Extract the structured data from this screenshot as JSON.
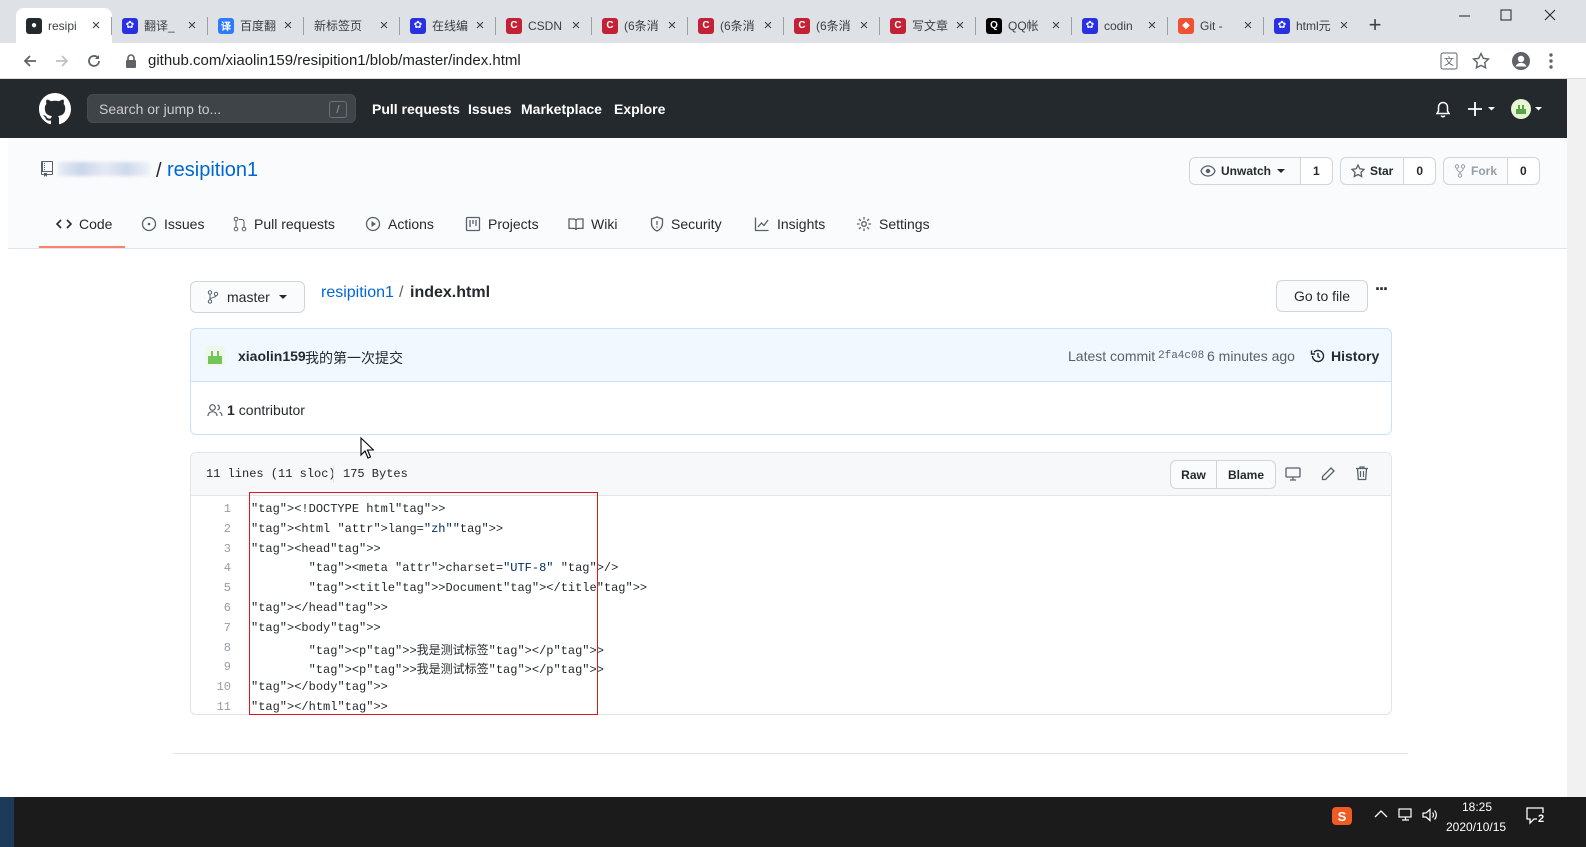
{
  "browser": {
    "tabs": [
      {
        "title": "resipi",
        "icon": "github-icon",
        "color": "#24292e"
      },
      {
        "title": "翻译_",
        "icon": "baidu-paw-icon",
        "color": "#2932e1"
      },
      {
        "title": "百度翻",
        "icon": "baidu-translate-icon",
        "color": "#2f7bff"
      },
      {
        "title": "新标签页",
        "icon": "none",
        "color": ""
      },
      {
        "title": "在线编",
        "icon": "baidu-paw-icon",
        "color": "#2932e1"
      },
      {
        "title": "CSDN",
        "icon": "csdn-icon",
        "color": "#c32136"
      },
      {
        "title": "(6条消",
        "icon": "csdn-icon",
        "color": "#c32136"
      },
      {
        "title": "(6条消",
        "icon": "csdn-icon",
        "color": "#c32136"
      },
      {
        "title": "(6条消",
        "icon": "csdn-icon",
        "color": "#c32136"
      },
      {
        "title": "写文章",
        "icon": "csdn-icon",
        "color": "#c32136"
      },
      {
        "title": "QQ帐",
        "icon": "qq-penguin-icon",
        "color": "#000"
      },
      {
        "title": "codin",
        "icon": "baidu-paw-icon",
        "color": "#2932e1"
      },
      {
        "title": "Git - ",
        "icon": "git-icon",
        "color": "#f05133"
      },
      {
        "title": "html元",
        "icon": "baidu-paw-icon",
        "color": "#2932e1"
      }
    ],
    "url": "github.com/xiaolin159/resipition1/blob/master/index.html"
  },
  "gh_header": {
    "search_placeholder": "Search or jump to...",
    "search_key": "/",
    "nav": [
      "Pull requests",
      "Issues",
      "Marketplace",
      "Explore"
    ]
  },
  "repo": {
    "name": "resipition1",
    "separator": "/",
    "watch_label": "Unwatch",
    "watch_count": "1",
    "star_label": "Star",
    "star_count": "0",
    "fork_label": "Fork",
    "fork_count": "0",
    "tabs": [
      "Code",
      "Issues",
      "Pull requests",
      "Actions",
      "Projects",
      "Wiki",
      "Security",
      "Insights",
      "Settings"
    ]
  },
  "file": {
    "branch": "master",
    "breadcrumb_repo": "resipition1",
    "breadcrumb_sep": "/",
    "breadcrumb_file": "index.html",
    "goto_label": "Go to file",
    "more_label": "···",
    "commit_author": "xiaolin159",
    "commit_message": "我的第一次提交",
    "latest_commit_label": "Latest commit",
    "commit_hash": "2fa4c08",
    "commit_time": "6 minutes ago",
    "history_label": "History",
    "contributors": "1",
    "contributors_label": "contributor",
    "lines_info": "11 lines (11 sloc)",
    "size_info": "175 Bytes",
    "raw_label": "Raw",
    "blame_label": "Blame",
    "code_lines": [
      "<!DOCTYPE html>",
      "<html lang=\"zh\">",
      "<head>",
      "\t<meta charset=\"UTF-8\" />",
      "\t<title>Document</title>",
      "</head>",
      "<body>",
      "\t<p>我是测试标签</p>",
      "\t<p>我是测试标签</p>",
      "</body>",
      "</html>"
    ]
  },
  "taskbar": {
    "time": "18:25",
    "date": "2020/10/15",
    "notification_count": "2"
  }
}
